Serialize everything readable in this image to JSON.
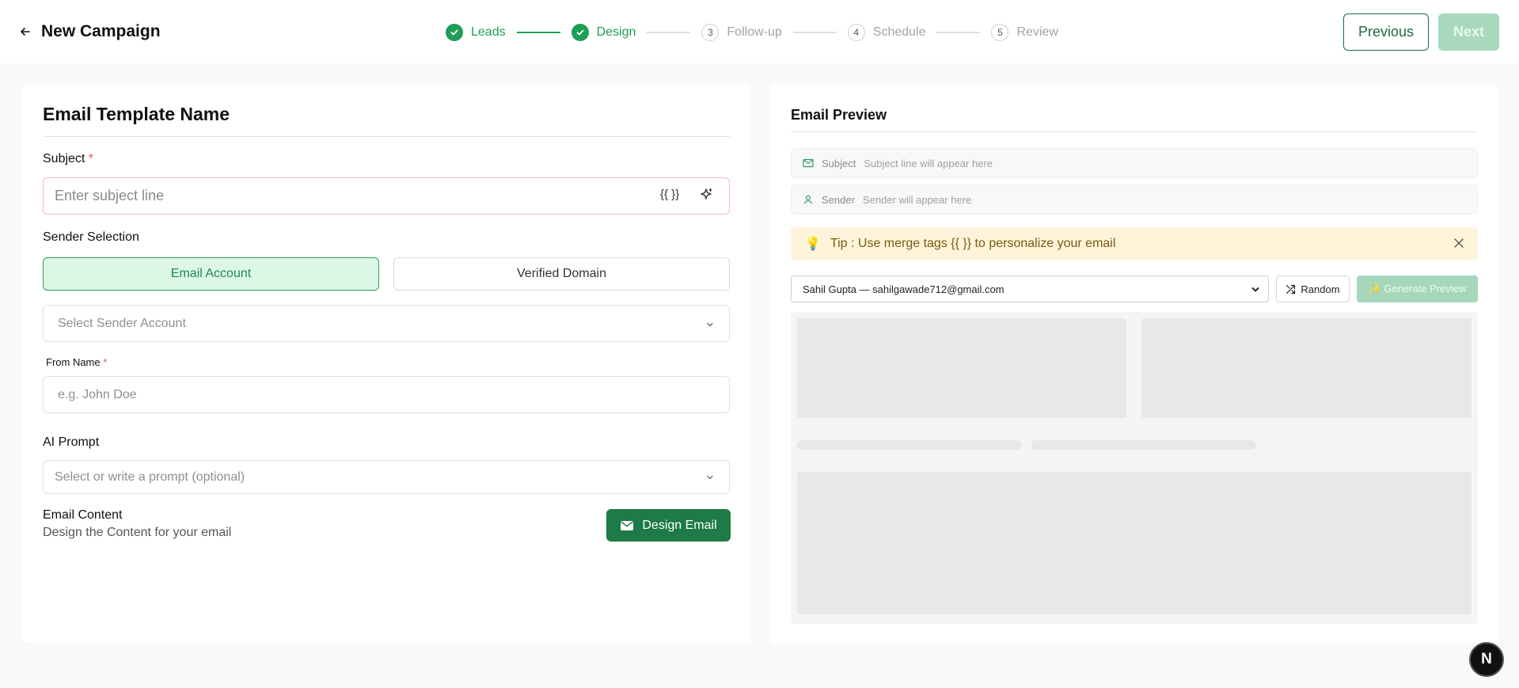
{
  "header": {
    "title": "New Campaign",
    "steps": [
      {
        "label": "Leads",
        "status": "done"
      },
      {
        "label": "Design",
        "status": "done"
      },
      {
        "number": "3",
        "label": "Follow-up",
        "status": "todo"
      },
      {
        "number": "4",
        "label": "Schedule",
        "status": "todo"
      },
      {
        "number": "5",
        "label": "Review",
        "status": "todo"
      }
    ],
    "previous_label": "Previous",
    "next_label": "Next"
  },
  "form": {
    "title": "Email Template Name",
    "subject": {
      "label": "Subject",
      "required": "*",
      "placeholder": "Enter subject line",
      "merge_tag_label": "{{ }}"
    },
    "sender_selection": {
      "label": "Sender Selection",
      "options": [
        "Email Account",
        "Verified Domain"
      ],
      "selected": "Email Account"
    },
    "sender_account": {
      "placeholder": "Select Sender Account"
    },
    "from_name": {
      "label": "From Name",
      "required": "*",
      "placeholder": "e.g. John Doe"
    },
    "ai_prompt": {
      "label": "AI Prompt",
      "placeholder": "Select or write a prompt (optional)"
    },
    "email_content": {
      "title": "Email Content",
      "subtitle": "Design the Content for your email",
      "button_label": "Design Email"
    }
  },
  "preview": {
    "title": "Email Preview",
    "subject_key": "Subject",
    "subject_value": "Subject line will appear here",
    "sender_key": "Sender",
    "sender_value": "Sender will appear here",
    "tip_icon": "💡",
    "tip_text": "Tip : Use merge tags {{ }} to personalize your email",
    "selected_lead": "Sahil Gupta — sahilgawade712@gmail.com",
    "random_label": "Random",
    "generate_label": "✨ Generate Preview"
  },
  "badge": {
    "letter": "N"
  },
  "colors": {
    "accent": "#1e9e56",
    "accent_dark": "#1e7a46",
    "tip_bg": "#fdf4d9",
    "required": "#e05252"
  },
  "icons": [
    "back-arrow-icon",
    "check-icon",
    "braces-icon",
    "sparkle-icon",
    "chevron-down-icon",
    "mail-icon",
    "user-icon",
    "close-icon",
    "shuffle-icon"
  ]
}
